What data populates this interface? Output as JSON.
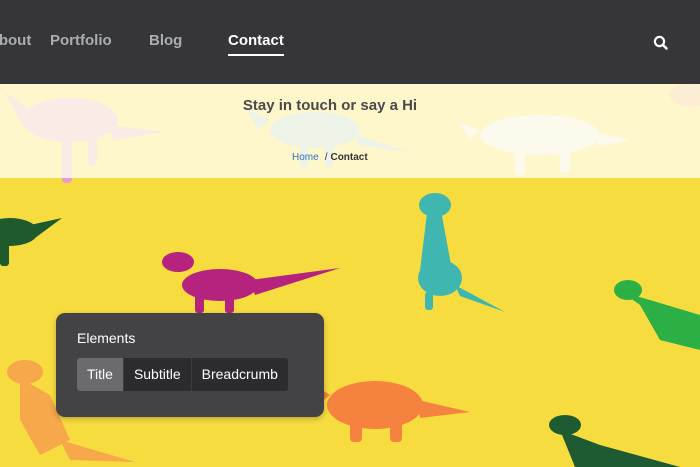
{
  "nav": {
    "items": [
      {
        "label": "About"
      },
      {
        "label": "Portfolio"
      },
      {
        "label": "Blog"
      },
      {
        "label": "Contact",
        "active": true
      }
    ],
    "search_icon": "search-icon"
  },
  "header": {
    "title": "Stay in touch or say a Hi",
    "breadcrumb": {
      "home": "Home",
      "separator": "/",
      "current": "Contact"
    }
  },
  "panel": {
    "title": "Elements",
    "options": [
      {
        "label": "Title",
        "active": true
      },
      {
        "label": "Subtitle"
      },
      {
        "label": "Breadcrumb"
      }
    ]
  },
  "colors": {
    "nav_bg": "#363538",
    "nav_text": "#a9aeb3",
    "nav_active": "#ffffff",
    "band_bg": "#fffcec",
    "link": "#2f72d0",
    "background": "#f7dc40",
    "panel_bg": "#434245"
  }
}
